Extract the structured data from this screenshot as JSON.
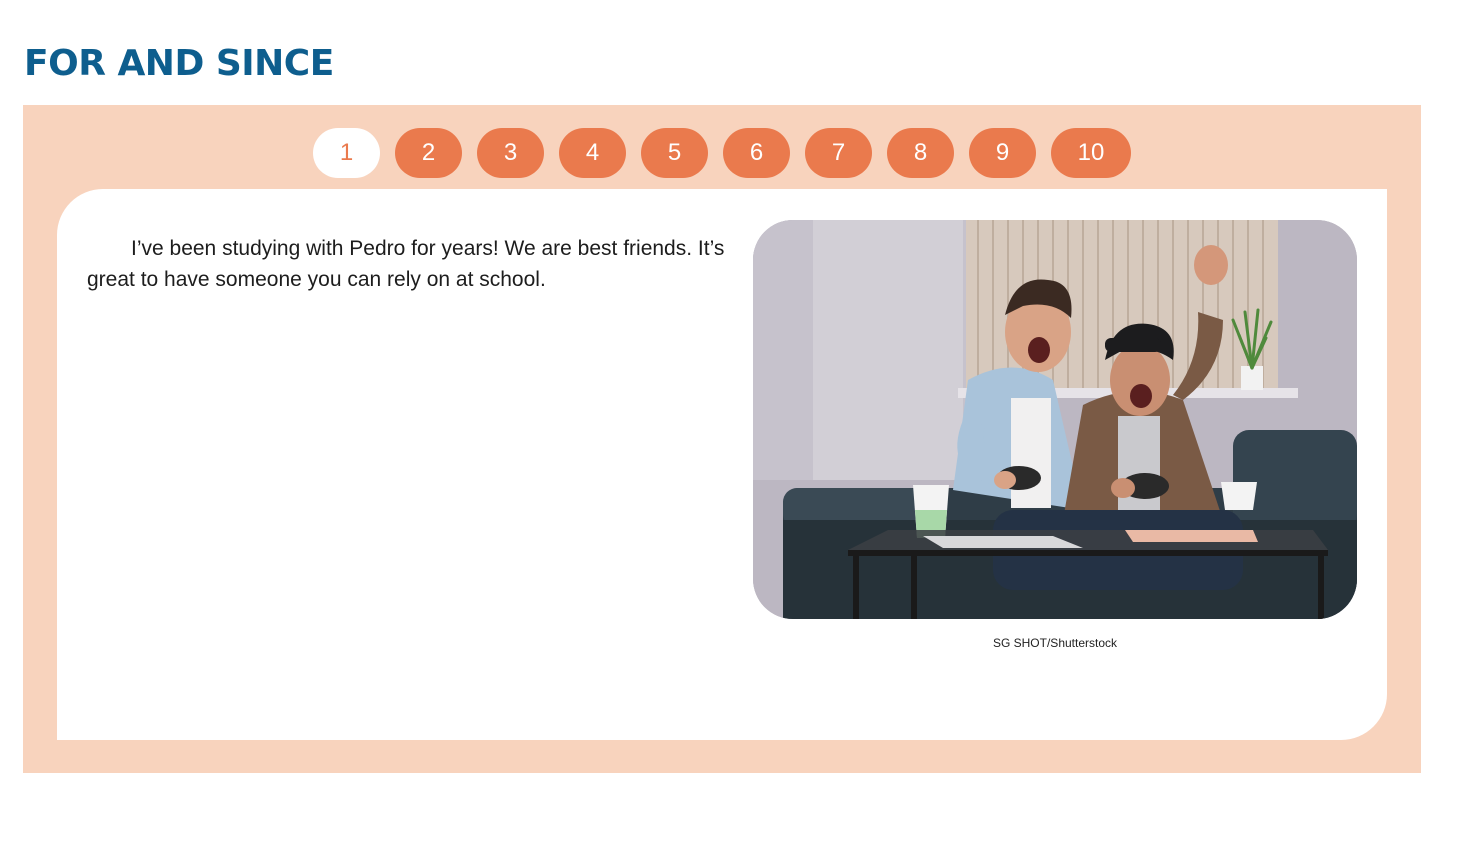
{
  "page": {
    "title": "FOR AND SINCE"
  },
  "pager": {
    "pages": [
      "1",
      "2",
      "3",
      "4",
      "5",
      "6",
      "7",
      "8",
      "9",
      "10"
    ],
    "active": "1"
  },
  "card": {
    "text": "I’ve been studying with Pedro for years! We are best friends. It’s great to have someone you can rely on at school.",
    "photo_credit": "SG SHOT/Shutterstock"
  },
  "colors": {
    "title": "#0e5e8e",
    "panel_background": "#f8d3bd",
    "page_button": "#ea7a4d",
    "active_page_button": "#ffffff"
  }
}
